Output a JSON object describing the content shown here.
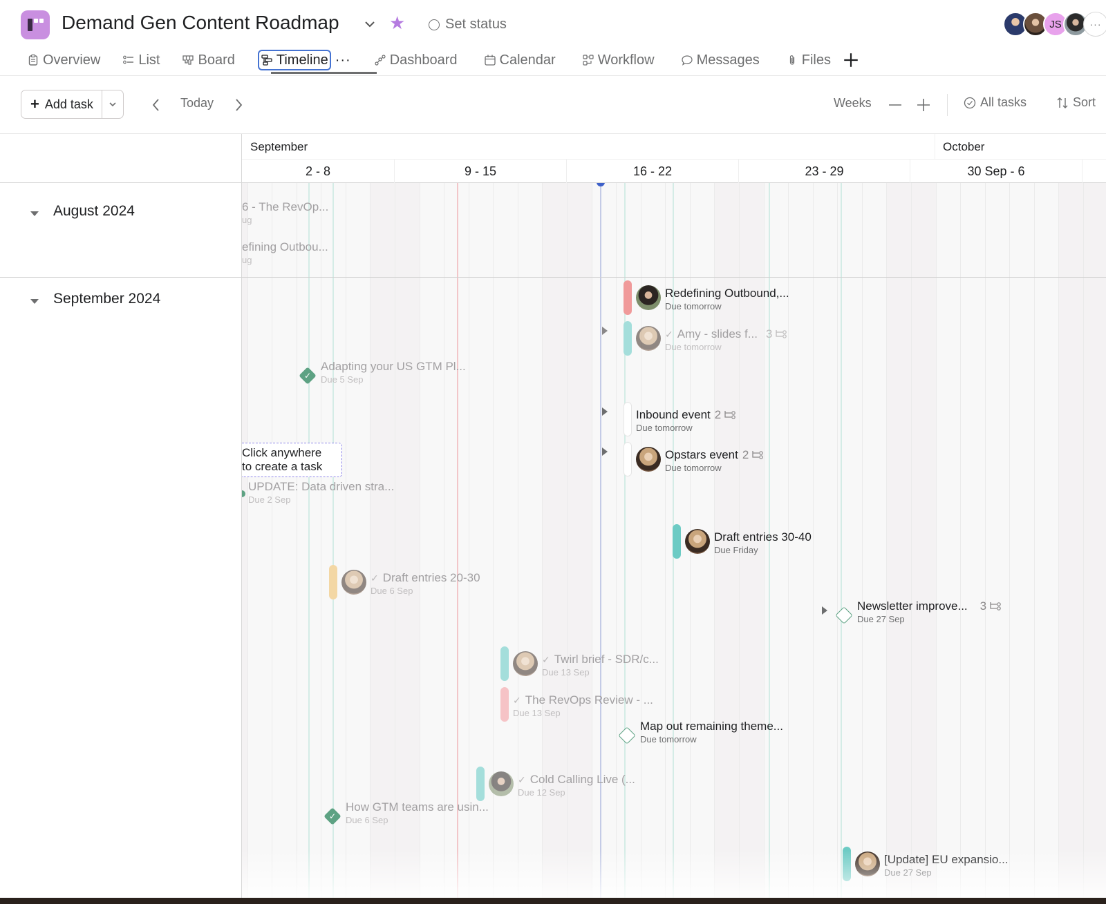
{
  "header": {
    "project_title": "Demand Gen Content Roadmap",
    "set_status_label": "Set status",
    "favorite": true,
    "accent_color": "#c98fe0",
    "members": [
      {
        "name": "member-1",
        "initials": ""
      },
      {
        "name": "member-2",
        "initials": ""
      },
      {
        "name": "member-3",
        "initials": "JS"
      },
      {
        "name": "member-4",
        "initials": ""
      }
    ],
    "members_more_label": "···"
  },
  "tabs": [
    {
      "label": "Overview",
      "icon": "clipboard-icon",
      "active": false
    },
    {
      "label": "List",
      "icon": "list-icon",
      "active": false
    },
    {
      "label": "Board",
      "icon": "board-icon",
      "active": false
    },
    {
      "label": "Timeline",
      "icon": "timeline-icon",
      "active": true
    },
    {
      "label": "Dashboard",
      "icon": "dashboard-icon",
      "active": false
    },
    {
      "label": "Calendar",
      "icon": "calendar-icon",
      "active": false
    },
    {
      "label": "Workflow",
      "icon": "workflow-icon",
      "active": false
    },
    {
      "label": "Messages",
      "icon": "message-icon",
      "active": false
    },
    {
      "label": "Files",
      "icon": "paperclip-icon",
      "active": false
    }
  ],
  "tab_more_label": "···",
  "toolbar": {
    "add_task_label": "Add task",
    "today_label": "Today",
    "zoom_level_label": "Weeks",
    "filter_label": "All tasks",
    "sort_label": "Sort"
  },
  "timeline": {
    "months": [
      {
        "label": "September"
      },
      {
        "label": "October"
      }
    ],
    "weeks": [
      "2 - 8",
      "9 - 15",
      "16 - 22",
      "23 - 29",
      "30 Sep - 6"
    ],
    "today_color": "#3d60c9"
  },
  "sections": [
    {
      "title": "August 2024"
    },
    {
      "title": "September 2024"
    }
  ],
  "hint": {
    "line1": "Click anywhere",
    "line2": "to create a task"
  },
  "tasks": {
    "aug_1": {
      "name": "6 - The RevOp...",
      "due": "ug"
    },
    "aug_2": {
      "name": "efining Outbou...",
      "due": "ug"
    },
    "t1": {
      "name": "Redefining Outbound,...",
      "due": "Due tomorrow",
      "color": "#f09a9a"
    },
    "t2": {
      "name": "Amy - slides f...",
      "due": "Due tomorrow",
      "subtasks": "3",
      "completed": true,
      "color": "#a4dedb"
    },
    "t3": {
      "name": "Adapting your US GTM Pl...",
      "due": "Due 5 Sep",
      "milestone": true,
      "completed": true
    },
    "t4": {
      "name": "Inbound event",
      "due": "Due tomorrow",
      "subtasks": "2"
    },
    "t5": {
      "name": "Opstars event",
      "due": "Due tomorrow",
      "subtasks": "2"
    },
    "t6": {
      "name": "UPDATE: Data driven stra...",
      "due": "Due 2 Sep"
    },
    "t7": {
      "name": "Draft entries 30-40",
      "due": "Due Friday",
      "color": "#6ccbc4"
    },
    "t8": {
      "name": "Draft entries 20-30",
      "due": "Due 6 Sep",
      "completed": true,
      "color": "#f3d7a4"
    },
    "t9": {
      "name": "Newsletter improve...",
      "due": "Due 27 Sep",
      "subtasks": "3",
      "milestone": true
    },
    "t10": {
      "name": "Twirl brief - SDR/c...",
      "due": "Due 13 Sep",
      "completed": true,
      "color": "#a4dedb"
    },
    "t11": {
      "name": "The RevOps Review - ...",
      "due": "Due 13 Sep",
      "completed": true,
      "color": "#f6c3c6"
    },
    "t12": {
      "name": "Map out remaining theme...",
      "due": "Due tomorrow",
      "milestone": true
    },
    "t13": {
      "name": "Cold Calling Live (...",
      "due": "Due 12 Sep",
      "completed": true,
      "color": "#a4dedb"
    },
    "t14": {
      "name": "How GTM teams are usin...",
      "due": "Due 6 Sep",
      "milestone": true,
      "completed": true
    },
    "t15": {
      "name": "[Update] EU expansio...",
      "due": "Due 27 Sep",
      "color": "#6ccbc4"
    }
  }
}
